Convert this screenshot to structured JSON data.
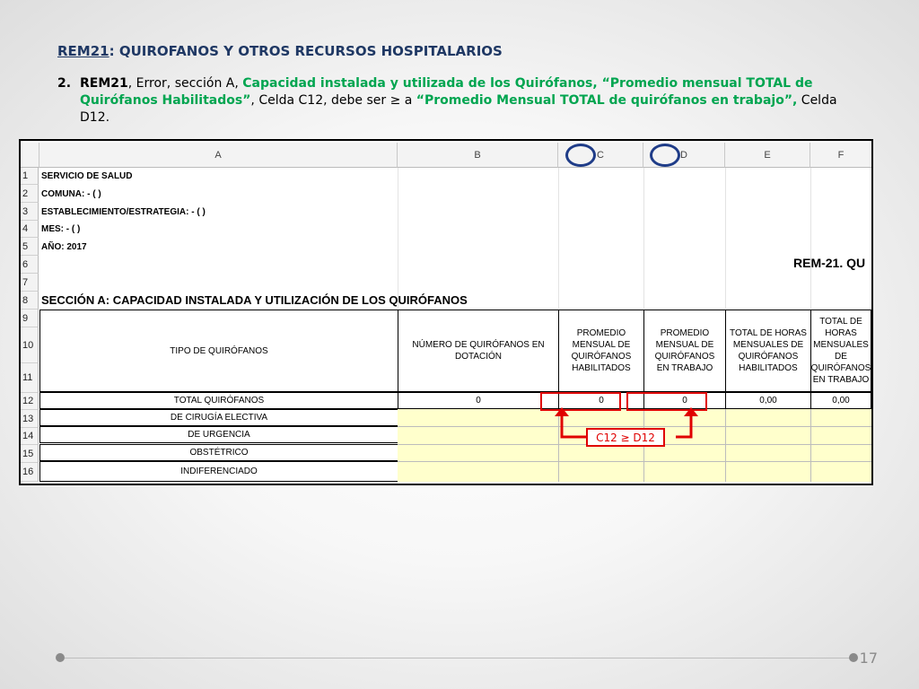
{
  "title": {
    "code": "REM21",
    "rest": ": QUIROFANOS Y OTROS RECURSOS HOSPITALARIOS"
  },
  "rule": {
    "number": "2.",
    "p1": "REM21",
    "p2": ", Error, sección A, ",
    "p3": "Capacidad instalada y utilizada de los Quirófanos,  “Promedio mensual TOTAL de Quirófanos Habilitados”",
    "p4": ", Celda C12, debe ser ≥ a ",
    "p5": "“Promedio Mensual TOTAL de quirófanos en trabajo”,",
    "p6": " Celda D12."
  },
  "sheet": {
    "columns": [
      "A",
      "B",
      "C",
      "D",
      "E",
      "F"
    ],
    "rows": [
      "1",
      "2",
      "3",
      "4",
      "5",
      "6",
      "7",
      "8",
      "9",
      "10",
      "11",
      "12",
      "13",
      "14",
      "15",
      "16"
    ],
    "info": [
      "SERVICIO DE SALUD",
      "COMUNA:  - (  )",
      "ESTABLECIMIENTO/ESTRATEGIA:  - (  )",
      "MES:  - (  )",
      "AÑO: 2017"
    ],
    "rem_title": "REM-21.   QU",
    "section": "SECCIÓN A:  CAPACIDAD INSTALADA Y UTILIZACIÓN DE LOS QUIRÓFANOS",
    "headers": [
      "TIPO DE QUIRÓFANOS",
      "NÚMERO DE QUIRÓFANOS EN DOTACIÓN",
      "PROMEDIO MENSUAL DE QUIRÓFANOS HABILITADOS",
      "PROMEDIO MENSUAL  DE QUIRÓFANOS EN TRABAJO",
      "TOTAL  DE HORAS MENSUALES DE QUIRÓFANOS HABILITADOS",
      "TOTAL DE HORAS MENSUALES DE QUIRÓFANOS EN TRABAJO"
    ],
    "total_row": [
      "TOTAL QUIRÓFANOS",
      "0",
      "0",
      "0",
      "0,00",
      "0,00"
    ],
    "sub_rows": [
      "DE CIRUGÍA ELECTIVA",
      "DE URGENCIA",
      "OBSTÉTRICO",
      "INDIFERENCIADO"
    ]
  },
  "comparison_label": "C12 ≥ D12",
  "page_number": "17",
  "colors": {
    "title": "#1f3864",
    "highlight": "#00a550",
    "red": "#e00000",
    "circle": "#1f3c88",
    "fill": "#ffffcc"
  }
}
